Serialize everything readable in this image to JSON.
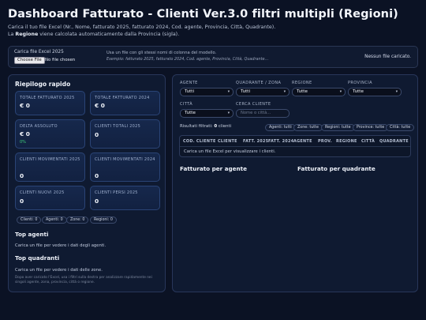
{
  "header": {
    "title": "Dashboard Fatturato - Clienti Ver.3.0 filtri multipli (Regioni)",
    "line1": "Carica il tuo file Excel (Nr., Nome, fatturato 2025, fatturato 2024, Cod. agente, Provincia, Città, Quadrante).",
    "line2_pre": "La ",
    "line2_bold": "Regione",
    "line2_post": " viene calcolata automaticamente dalla Provincia (sigla)."
  },
  "upload": {
    "label": "Carica file Excel 2025",
    "choose_button": "Choose File",
    "no_file": "No file chosen",
    "hint": "Usa un file con gli stessi nomi di colonna del modello.",
    "columns_hint": "Esempio: fatturato 2025, fatturato 2024, Cod. agente, Provincia, Città, Quadrante…",
    "status": "Nessun file caricato."
  },
  "summary": {
    "title": "Riepilogo rapido",
    "cards": [
      {
        "label": "TOTALE FATTURATO 2025",
        "value": "€ 0",
        "delta": ""
      },
      {
        "label": "TOTALE FATTURATO 2024",
        "value": "€ 0",
        "delta": ""
      },
      {
        "label": "DELTA ASSOLUTO",
        "value": "€ 0",
        "delta": "0%"
      },
      {
        "label": "CLIENTI TOTALI 2025",
        "value": "0",
        "delta": ""
      },
      {
        "label": "CLIENTI MOVIMENTATI 2025",
        "value": "0",
        "delta": ""
      },
      {
        "label": "CLIENTI MOVIMENTATI 2024",
        "value": "0",
        "delta": ""
      },
      {
        "label": "CLIENTI NUOVI 2025",
        "value": "0",
        "delta": ""
      },
      {
        "label": "CLIENTI PERSI 2025",
        "value": "0",
        "delta": ""
      }
    ],
    "chips": [
      "Clienti: 0",
      "Agenti: 0",
      "Zone: 0",
      "Regioni: 0"
    ],
    "top_agents_title": "Top agenti",
    "top_agents_text": "Carica un file per vedere i dati degli agenti.",
    "top_quadrants_title": "Top quadranti",
    "top_quadrants_text": "Carica un file per vedere i dati delle zone.",
    "note": "Dopo aver caricato l'Excel, usa i filtri sulla destra per analizzare rapidamente nei singoli agente, zona, provincia, città o regione."
  },
  "filters": {
    "agente": {
      "label": "AGENTE",
      "value": "Tutti"
    },
    "quadrante": {
      "label": "QUADRANTE / ZONA",
      "value": "Tutti"
    },
    "regione": {
      "label": "REGIONE",
      "value": "Tutte"
    },
    "provincia": {
      "label": "PROVINCIA",
      "value": "Tutte"
    },
    "citta": {
      "label": "CITTÀ",
      "value": "Tutte"
    },
    "cerca": {
      "label": "CERCA CLIENTE",
      "placeholder": "Nome o città..."
    },
    "result_pre": "Risultati filtrati: ",
    "result_count": "0",
    "result_post": " clienti",
    "reset_chips": [
      "Agenti: tutti",
      "Zone: tutte",
      "Regioni: tutte",
      "Province: tutte",
      "Città: tutte"
    ]
  },
  "table": {
    "headers": [
      "COD. CLIENTE",
      "CLIENTE",
      "FATT. 2025",
      "FATT. 2024",
      "AGENTE",
      "PROV.",
      "REGIONE",
      "CITTÀ",
      "QUADRANTE"
    ],
    "empty_text": "Carica un file Excel per visualizzare i clienti."
  },
  "charts": {
    "agent_title": "Fatturato per agente",
    "quadrant_title": "Fatturato per quadrante"
  },
  "colors": {
    "background": "#0b1224",
    "panel": "#0f1a31",
    "card": "#16284c",
    "delta_positive": "#3fd07a"
  }
}
